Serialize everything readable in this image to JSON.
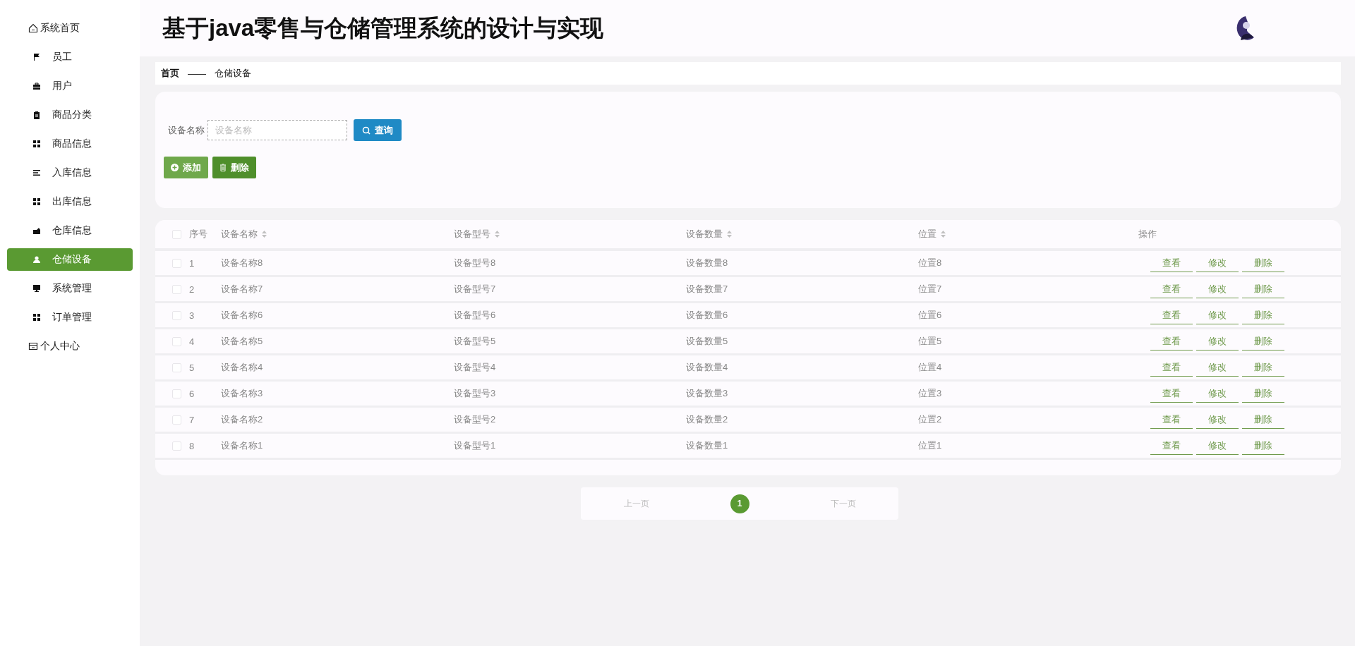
{
  "header": {
    "title": "基于java零售与仓储管理系统的设计与实现"
  },
  "sidebar": {
    "items": [
      {
        "kind": "top",
        "label": "系统首页",
        "selected": false
      },
      {
        "kind": "sub",
        "label": "员工",
        "selected": false
      },
      {
        "kind": "sub",
        "label": "用户",
        "selected": false
      },
      {
        "kind": "sub",
        "label": "商品分类",
        "selected": false
      },
      {
        "kind": "sub",
        "label": "商品信息",
        "selected": false
      },
      {
        "kind": "sub",
        "label": "入库信息",
        "selected": false
      },
      {
        "kind": "sub",
        "label": "出库信息",
        "selected": false
      },
      {
        "kind": "sub",
        "label": "仓库信息",
        "selected": false
      },
      {
        "kind": "sub",
        "label": "仓储设备",
        "selected": true
      },
      {
        "kind": "sub",
        "label": "系统管理",
        "selected": false
      },
      {
        "kind": "sub",
        "label": "订单管理",
        "selected": false
      },
      {
        "kind": "top",
        "label": "个人中心",
        "selected": false
      }
    ]
  },
  "breadcrumb": {
    "home": "首页",
    "separator": "——",
    "current": "仓储设备"
  },
  "search": {
    "label": "设备名称",
    "placeholder": "设备名称",
    "button": "查询"
  },
  "actions": [
    "添加",
    "删除"
  ],
  "table": {
    "header_checked": false,
    "columns": [
      {
        "label": "序号",
        "sortable": false
      },
      {
        "label": "设备名称",
        "sortable": true
      },
      {
        "label": "设备型号",
        "sortable": true
      },
      {
        "label": "设备数量",
        "sortable": true
      },
      {
        "label": "位置",
        "sortable": true
      },
      {
        "label": "操作",
        "sortable": false
      }
    ],
    "rows": [
      {
        "checked": false,
        "cells": [
          "1",
          "设备名称8",
          "设备型号8",
          "设备数量8",
          "位置8"
        ],
        "actions": [
          "查看",
          "修改",
          "删除"
        ]
      },
      {
        "checked": false,
        "cells": [
          "2",
          "设备名称7",
          "设备型号7",
          "设备数量7",
          "位置7"
        ],
        "actions": [
          "查看",
          "修改",
          "删除"
        ]
      },
      {
        "checked": false,
        "cells": [
          "3",
          "设备名称6",
          "设备型号6",
          "设备数量6",
          "位置6"
        ],
        "actions": [
          "查看",
          "修改",
          "删除"
        ]
      },
      {
        "checked": false,
        "cells": [
          "4",
          "设备名称5",
          "设备型号5",
          "设备数量5",
          "位置5"
        ],
        "actions": [
          "查看",
          "修改",
          "删除"
        ]
      },
      {
        "checked": false,
        "cells": [
          "5",
          "设备名称4",
          "设备型号4",
          "设备数量4",
          "位置4"
        ],
        "actions": [
          "查看",
          "修改",
          "删除"
        ]
      },
      {
        "checked": false,
        "cells": [
          "6",
          "设备名称3",
          "设备型号3",
          "设备数量3",
          "位置3"
        ],
        "actions": [
          "查看",
          "修改",
          "删除"
        ]
      },
      {
        "checked": false,
        "cells": [
          "7",
          "设备名称2",
          "设备型号2",
          "设备数量2",
          "位置2"
        ],
        "actions": [
          "查看",
          "修改",
          "删除"
        ]
      },
      {
        "checked": false,
        "cells": [
          "8",
          "设备名称1",
          "设备型号1",
          "设备数量1",
          "位置1"
        ],
        "actions": [
          "查看",
          "修改",
          "删除"
        ]
      }
    ]
  },
  "pagination": {
    "prev": "上一页",
    "pages": [
      {
        "label": "1",
        "selected": true
      }
    ],
    "next": "下一页"
  }
}
